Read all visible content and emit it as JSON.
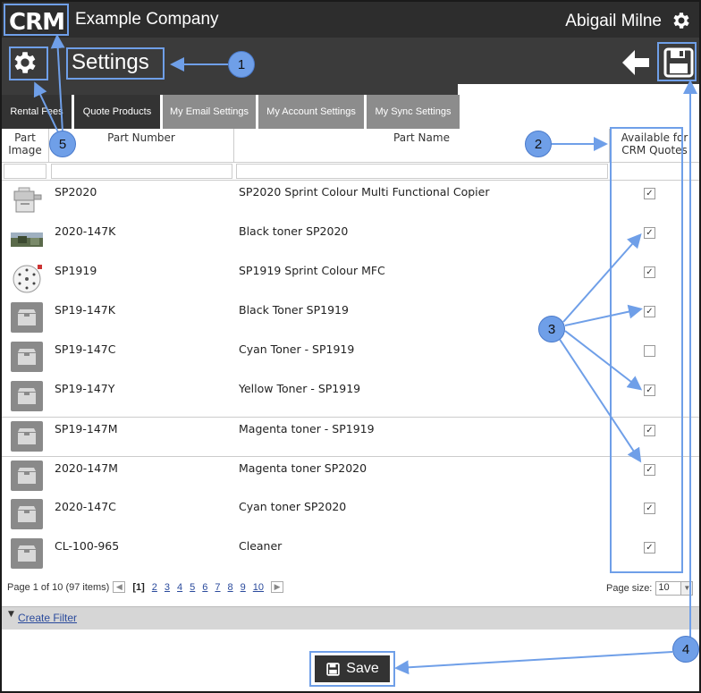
{
  "header": {
    "logo_text": "CRM",
    "company": "Example Company",
    "user": "Abigail Milne"
  },
  "settings_bar": {
    "title": "Settings"
  },
  "tabs": [
    {
      "label": "Rental Fees"
    },
    {
      "label": "Quote Products"
    },
    {
      "label": "My Email Settings"
    },
    {
      "label": "My Account Settings"
    },
    {
      "label": "My Sync Settings"
    }
  ],
  "grid": {
    "columns": {
      "image_l1": "Part",
      "image_l2": "Image",
      "number": "Part Number",
      "name": "Part Name",
      "avail_l1": "Available for",
      "avail_l2": "CRM Quotes"
    },
    "rows": [
      {
        "number": "SP2020",
        "name": "SP2020 Sprint Colour Multi Functional Copier",
        "checked": true,
        "image": "copier"
      },
      {
        "number": "2020-147K",
        "name": "Black toner SP2020",
        "checked": true,
        "image": "photo"
      },
      {
        "number": "SP1919",
        "name": "SP1919 Sprint Colour MFC",
        "checked": true,
        "image": "dial"
      },
      {
        "number": "SP19-147K",
        "name": "Black Toner SP1919",
        "checked": true,
        "image": "box"
      },
      {
        "number": "SP19-147C",
        "name": "Cyan Toner - SP1919",
        "checked": false,
        "image": "box"
      },
      {
        "number": "SP19-147Y",
        "name": "Yellow Toner - SP1919",
        "checked": true,
        "image": "box"
      },
      {
        "number": "SP19-147M",
        "name": "Magenta toner - SP1919",
        "checked": true,
        "image": "box"
      },
      {
        "number": "2020-147M",
        "name": "Magenta toner SP2020",
        "checked": true,
        "image": "box"
      },
      {
        "number": "2020-147C",
        "name": "Cyan toner SP2020",
        "checked": true,
        "image": "box"
      },
      {
        "number": "CL-100-965",
        "name": "Cleaner",
        "checked": true,
        "image": "box"
      }
    ]
  },
  "pager": {
    "summary": "Page 1 of 10 (97 items)",
    "current": "[1]",
    "pages": [
      "2",
      "3",
      "4",
      "5",
      "6",
      "7",
      "8",
      "9",
      "10"
    ],
    "page_size_label": "Page size:",
    "page_size": "10"
  },
  "filter": {
    "create_label": "Create Filter"
  },
  "save_button": {
    "label": "Save"
  },
  "annotations": [
    "1",
    "2",
    "3",
    "4",
    "5"
  ],
  "colors": {
    "topbar": "#2d2d2d",
    "settings_bar": "#3b3b3b",
    "tab_inactive": "#8c8c8c",
    "tab_active": "#333333",
    "annotation": "#6f9fe8",
    "link": "#2a4a9c"
  }
}
